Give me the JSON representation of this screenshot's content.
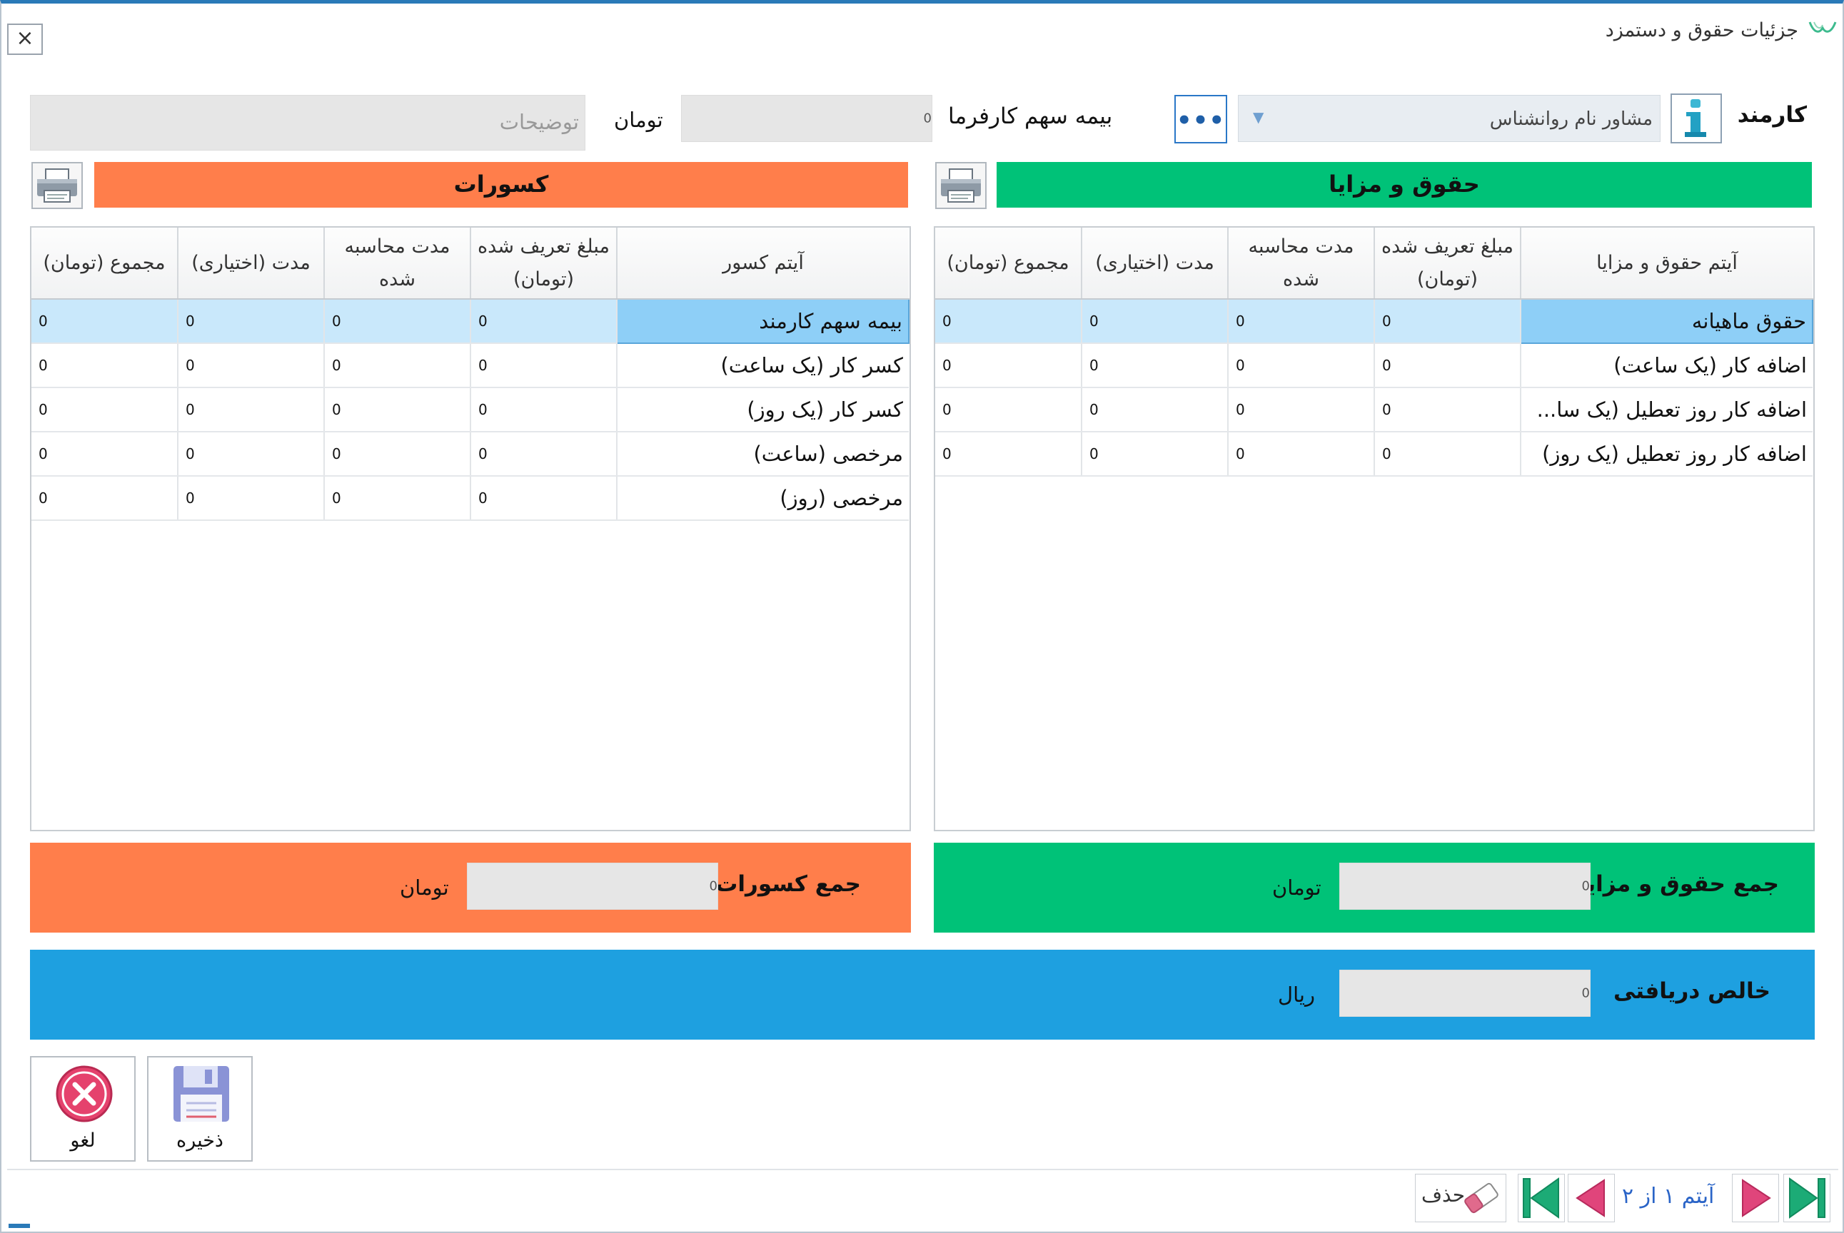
{
  "window": {
    "title": "جزئیات حقوق و دستمزد",
    "close_glyph": "×"
  },
  "employee": {
    "label": "کارمند",
    "value": "مشاور نام روانشناس",
    "browse_glyph": "•••"
  },
  "employer_insurance": {
    "label": "بیمه سهم کارفرما",
    "value": "0",
    "unit": "تومان"
  },
  "description": {
    "placeholder": "توضیحات"
  },
  "benefits": {
    "header": "حقوق و مزایا",
    "columns": [
      "آیتم حقوق و مزایا",
      "مبلغ تعریف شده (تومان)",
      "مدت محاسبه شده",
      "مدت (اختیاری)",
      "مجموع (تومان)"
    ],
    "rows": [
      {
        "item": "حقوق ماهیانه",
        "amount": "0",
        "calc": "0",
        "optional": "0",
        "total": "0"
      },
      {
        "item": "اضافه کار (یک ساعت)",
        "amount": "0",
        "calc": "0",
        "optional": "0",
        "total": "0"
      },
      {
        "item": "اضافه کار روز تعطیل (یک سا...",
        "amount": "0",
        "calc": "0",
        "optional": "0",
        "total": "0"
      },
      {
        "item": "اضافه کار روز تعطیل (یک روز)",
        "amount": "0",
        "calc": "0",
        "optional": "0",
        "total": "0"
      }
    ],
    "total_label": "جمع حقوق و مزایا",
    "total_value": "0",
    "unit": "تومان"
  },
  "deductions": {
    "header": "کسورات",
    "columns": [
      "آیتم کسور",
      "مبلغ تعریف شده (تومان)",
      "مدت محاسبه شده",
      "مدت (اختیاری)",
      "مجموع (تومان)"
    ],
    "rows": [
      {
        "item": "بیمه سهم کارمند",
        "amount": "0",
        "calc": "0",
        "optional": "0",
        "total": "0"
      },
      {
        "item": "کسر کار (یک ساعت)",
        "amount": "0",
        "calc": "0",
        "optional": "0",
        "total": "0"
      },
      {
        "item": "کسر کار (یک روز)",
        "amount": "0",
        "calc": "0",
        "optional": "0",
        "total": "0"
      },
      {
        "item": "مرخصی (ساعت)",
        "amount": "0",
        "calc": "0",
        "optional": "0",
        "total": "0"
      },
      {
        "item": "مرخصی (روز)",
        "amount": "0",
        "calc": "0",
        "optional": "0",
        "total": "0"
      }
    ],
    "total_label": "جمع کسورات",
    "total_value": "0",
    "unit": "تومان"
  },
  "net": {
    "label": "خالص دریافتی",
    "value": "0",
    "unit": "ریال"
  },
  "actions": {
    "save": "ذخیره",
    "cancel": "لغو"
  },
  "navigator": {
    "position_text": "آیتم ۱ از ۲",
    "delete": "حذف"
  },
  "colors": {
    "benefits_green": "#00c278",
    "deductions_orange": "#ff7e4b",
    "net_blue": "#1ea0e0",
    "selected_row": "#c9e8fb",
    "selected_cell": "#8ecff7",
    "accent_blue": "#2a77c7",
    "nav_magenta": "#e0457b",
    "nav_green": "#1cab76"
  }
}
